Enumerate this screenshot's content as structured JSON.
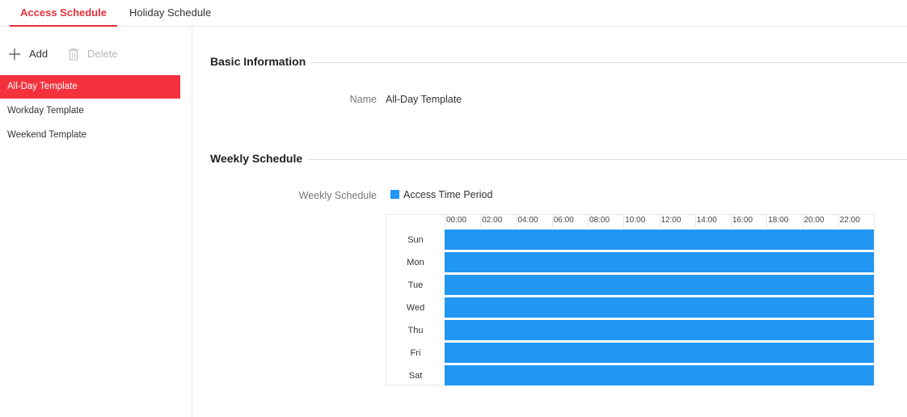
{
  "tabs": [
    {
      "label": "Access Schedule",
      "active": true
    },
    {
      "label": "Holiday Schedule",
      "active": false
    }
  ],
  "toolbar": {
    "add_label": "Add",
    "add_icon": "plus-icon",
    "delete_label": "Delete",
    "delete_icon": "trash-icon"
  },
  "templates": [
    {
      "label": "All-Day Template",
      "active": true
    },
    {
      "label": "Workday Template",
      "active": false
    },
    {
      "label": "Weekend Template",
      "active": false
    }
  ],
  "basic_info": {
    "title": "Basic Information",
    "name_label": "Name",
    "name_value": "All-Day Template"
  },
  "weekly": {
    "title": "Weekly Schedule",
    "label": "Weekly Schedule",
    "legend_label": "Access Time Period",
    "legend_color": "#2196f3",
    "hours": [
      "00:00",
      "02:00",
      "04:00",
      "06:00",
      "08:00",
      "10:00",
      "12:00",
      "14:00",
      "16:00",
      "18:00",
      "20:00",
      "22:00"
    ],
    "days": [
      {
        "label": "Sun",
        "start": "00:00",
        "end": "24:00"
      },
      {
        "label": "Mon",
        "start": "00:00",
        "end": "24:00"
      },
      {
        "label": "Tue",
        "start": "00:00",
        "end": "24:00"
      },
      {
        "label": "Wed",
        "start": "00:00",
        "end": "24:00"
      },
      {
        "label": "Thu",
        "start": "00:00",
        "end": "24:00"
      },
      {
        "label": "Fri",
        "start": "00:00",
        "end": "24:00"
      },
      {
        "label": "Sat",
        "start": "00:00",
        "end": "24:00"
      }
    ]
  },
  "colors": {
    "accent": "#e8303b",
    "active_item_bg": "#f5313d",
    "period": "#2196f3"
  }
}
